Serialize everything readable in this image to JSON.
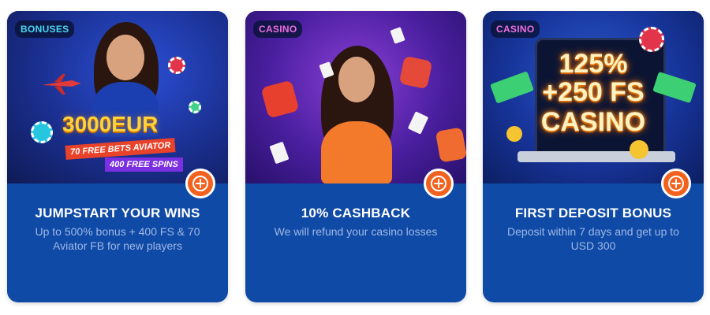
{
  "cards": [
    {
      "badge": "BONUSES",
      "title": "JUMPSTART YOUR WINS",
      "description": "Up to 500% bonus + 400 FS & 70 Aviator FB for new players",
      "image_text": {
        "amount": "3000EUR",
        "ribbon_1": "70 FREE BETS AVIATOR",
        "ribbon_2": "400 FREE SPINS"
      }
    },
    {
      "badge": "CASINO",
      "title": "10% CASHBACK",
      "description": "We will refund your casino losses"
    },
    {
      "badge": "CASINO",
      "title": "FIRST DEPOSIT BONUS",
      "description": "Deposit within 7 days and get up to USD 300",
      "image_text": {
        "line_1": "125%",
        "line_2": "+250 FS",
        "line_3": "CASINO"
      }
    }
  ],
  "icons": {
    "add": "plus-circle-icon"
  },
  "colors": {
    "card_body": "#0f4aa6",
    "accent": "#f2611e",
    "title": "#ffffff",
    "description": "#9fb8e6",
    "badge_bonuses": "#49d7f0",
    "badge_casino": "#f06fe0"
  }
}
